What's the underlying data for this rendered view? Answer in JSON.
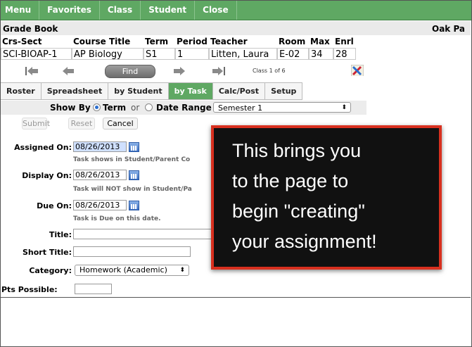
{
  "menu": {
    "items": [
      "Menu",
      "Favorites",
      "Class",
      "Student",
      "Close"
    ]
  },
  "gradebook": {
    "title": "Grade Book",
    "school": "Oak Pa"
  },
  "course_table": {
    "headers": [
      "Crs-Sect",
      "Course Title",
      "Term",
      "Period",
      "Teacher",
      "Room",
      "Max",
      "Enrl"
    ],
    "values": [
      "SCI-BIOAP-1",
      "AP Biology",
      "S1",
      "1",
      "Litten, Laura",
      "E-02",
      "34",
      "28"
    ]
  },
  "nav": {
    "find_label": "Find",
    "class_count": "Class 1 of 6"
  },
  "tabs": [
    "Roster",
    "Spreadsheet",
    "by Student",
    "by Task",
    "Calc/Post",
    "Setup"
  ],
  "show_by": {
    "label": "Show By",
    "term_label": "Term",
    "or_label": "or",
    "date_range_label": "Date Range",
    "selected": "Semester 1"
  },
  "actions": {
    "submit": "Submit",
    "reset": "Reset",
    "cancel": "Cancel"
  },
  "form": {
    "assigned_on_label": "Assigned On:",
    "assigned_on_value": "08/26/2013",
    "assigned_hint": "Task shows in Student/Parent Co",
    "display_on_label": "Display On:",
    "display_on_value": "08/26/2013",
    "display_hint": "Task will NOT show in Student/Pa",
    "due_on_label": "Due On:",
    "due_on_value": "08/26/2013",
    "due_hint": "Task is Due on this date.",
    "title_label": "Title:",
    "title_value": "",
    "short_title_label": "Short Title:",
    "short_title_value": "",
    "category_label": "Category:",
    "category_value": "Homework (Academic)",
    "pts_label": "Pts Possible:",
    "pts_value": ""
  },
  "callout": {
    "lines": [
      "This brings you",
      "to the page to",
      "begin \"creating\"",
      "your assignment!"
    ],
    "border_color": "#d8301f"
  },
  "colors": {
    "accent_green": "#5fa863"
  }
}
